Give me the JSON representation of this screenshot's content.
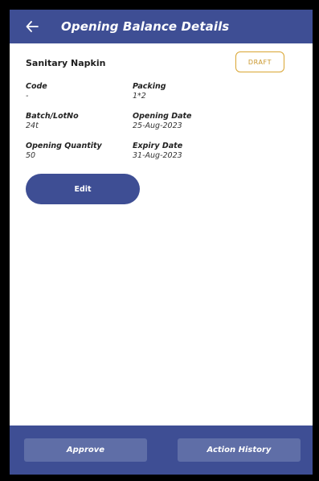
{
  "header": {
    "title": "Opening Balance Details"
  },
  "item": {
    "name": "Sanitary Napkin",
    "status": "DRAFT"
  },
  "fields": {
    "code": {
      "label": "Code",
      "value": "-"
    },
    "packing": {
      "label": "Packing",
      "value": "1*2"
    },
    "batch": {
      "label": "Batch/LotNo",
      "value": "24t"
    },
    "opening_date": {
      "label": "Opening Date",
      "value": "25-Aug-2023"
    },
    "opening_quantity": {
      "label": "Opening Quantity",
      "value": "50"
    },
    "expiry_date": {
      "label": "Expiry Date",
      "value": "31-Aug-2023"
    }
  },
  "actions": {
    "edit_label": "Edit",
    "approve_label": "Approve",
    "history_label": "Action History"
  },
  "colors": {
    "primary": "#3e4e94",
    "footer_button": "#5f6ea7",
    "draft_badge": "#d9a531"
  },
  "icons": {
    "back": "arrow-left-icon"
  }
}
